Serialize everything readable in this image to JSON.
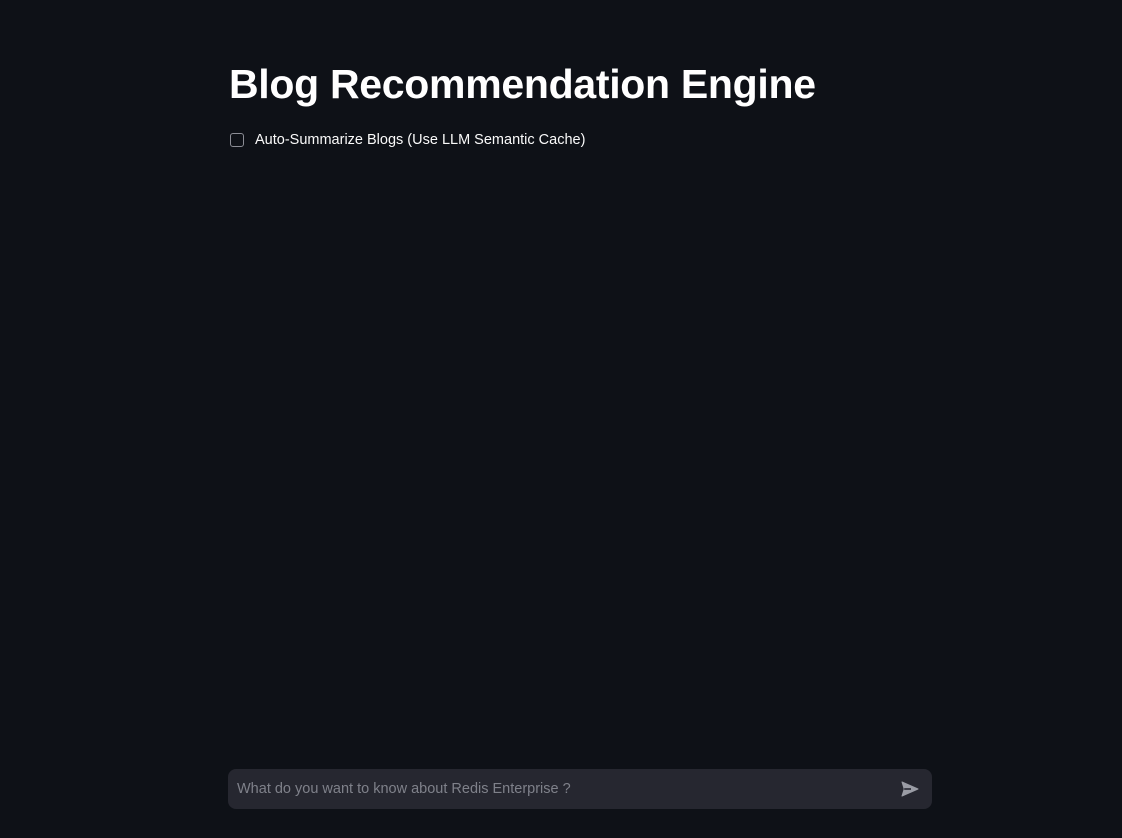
{
  "page": {
    "title": "Blog Recommendation Engine"
  },
  "options": {
    "auto_summarize": {
      "label": "Auto-Summarize Blogs (Use LLM Semantic Cache)",
      "checked": false
    }
  },
  "chat": {
    "placeholder": "What do you want to know about Redis Enterprise ?",
    "value": "",
    "send_icon": "send-icon"
  },
  "colors": {
    "background": "#0e1117",
    "input_background": "#262730",
    "text": "#fafafa",
    "placeholder": "#7f818a",
    "checkbox_border": "#8b8d95",
    "send_icon": "#9a9ca5"
  }
}
